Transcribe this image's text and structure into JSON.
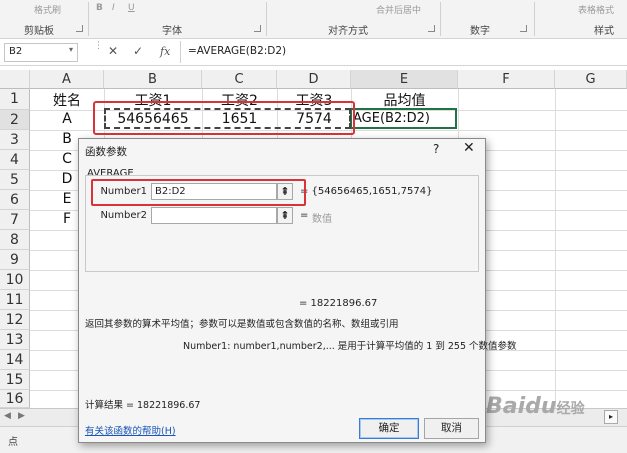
{
  "ribbon": {
    "groups": [
      "剪贴板",
      "字体",
      "对齐方式",
      "数字",
      "样式"
    ],
    "ghost_items": [
      "格式刷",
      "B",
      "I",
      "U",
      "合并后居中",
      "表格格式"
    ]
  },
  "formula_bar": {
    "name_box": "B2",
    "name_box_arrow": "▾",
    "cancel": "✕",
    "enter": "✓",
    "fx": "fx",
    "formula": "=AVERAGE(B2:D2)"
  },
  "grid": {
    "columns": [
      "A",
      "B",
      "C",
      "D",
      "E",
      "F",
      "G"
    ],
    "rows": [
      "1",
      "2",
      "3",
      "4",
      "5",
      "6",
      "7",
      "8",
      "9",
      "10",
      "11",
      "12",
      "13",
      "14",
      "15",
      "16"
    ],
    "row1": [
      "姓名",
      "工资1",
      "工资2",
      "工资3",
      "品均值"
    ],
    "row2": [
      "A",
      "54656465",
      "1651",
      "7574",
      "AGE(B2:D2)"
    ],
    "col_a": [
      "B",
      "C",
      "D",
      "E",
      "F"
    ]
  },
  "dialog": {
    "title": "函数参数",
    "help_btn": "?",
    "close_btn": "✕",
    "function_name": "AVERAGE",
    "number1_label": "Number1",
    "number1_value": "B2:D2",
    "number1_result": "= {54656465,1651,7574}",
    "number2_label": "Number2",
    "number2_eq": "=",
    "number2_hint": "数值",
    "collapse_glyph": "⇞",
    "result_preview": "= 18221896.67",
    "description": "返回其参数的算术平均值；参数可以是数值或包含数值的名称、数组或引用",
    "arg_help": "Number1:  number1,number2,... 是用于计算平均值的 1 到 255 个数值参数",
    "calc_result": "计算结果 =   18221896.67",
    "help_link": "有关该函数的帮助(H)",
    "ok": "确定",
    "cancel": "取消"
  },
  "status": {
    "mode_char": "点"
  },
  "watermark": {
    "text": "Baidu",
    "suffix": "经验"
  }
}
